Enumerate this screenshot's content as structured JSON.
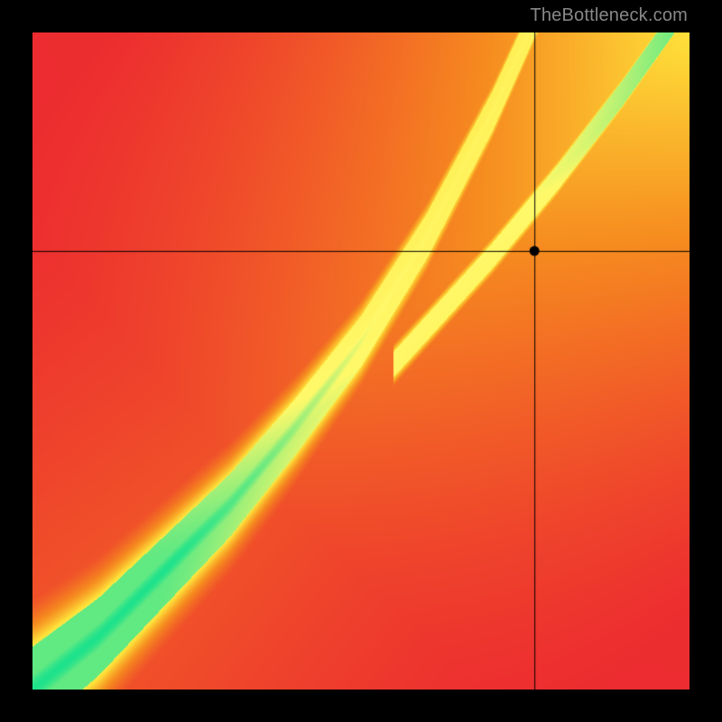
{
  "attribution": "TheBottleneck.com",
  "chart_data": {
    "type": "heatmap",
    "title": "",
    "xlabel": "",
    "ylabel": "",
    "xlim": [
      0,
      1
    ],
    "ylim": [
      0,
      1
    ],
    "gradient_stops": [
      {
        "v": 0.0,
        "color": "#ec2a30"
      },
      {
        "v": 0.4,
        "color": "#f68c1f"
      },
      {
        "v": 0.7,
        "color": "#ffe23a"
      },
      {
        "v": 0.9,
        "color": "#fff96a"
      },
      {
        "v": 1.0,
        "color": "#1de28c"
      }
    ],
    "ridge": {
      "note": "Green band: y ≈ f(x) where f is superlinear; band width shrinks as x grows",
      "x_samples": [
        0.0,
        0.1,
        0.2,
        0.3,
        0.4,
        0.5,
        0.6,
        0.7,
        0.8,
        0.9,
        1.0
      ],
      "y_center": [
        0.0,
        0.08,
        0.18,
        0.28,
        0.4,
        0.53,
        0.69,
        0.88,
        1.1,
        1.35,
        1.65
      ]
    },
    "secondary_ridge": {
      "note": "Faint yellow band branching to the right at high y",
      "x_samples": [
        0.6,
        0.7,
        0.8,
        0.9,
        1.0
      ],
      "y_center": [
        0.55,
        0.66,
        0.78,
        0.91,
        1.05
      ]
    },
    "marker": {
      "x": 0.765,
      "y": 0.667
    },
    "crosshair": {
      "x": 0.765,
      "y": 0.667
    }
  }
}
